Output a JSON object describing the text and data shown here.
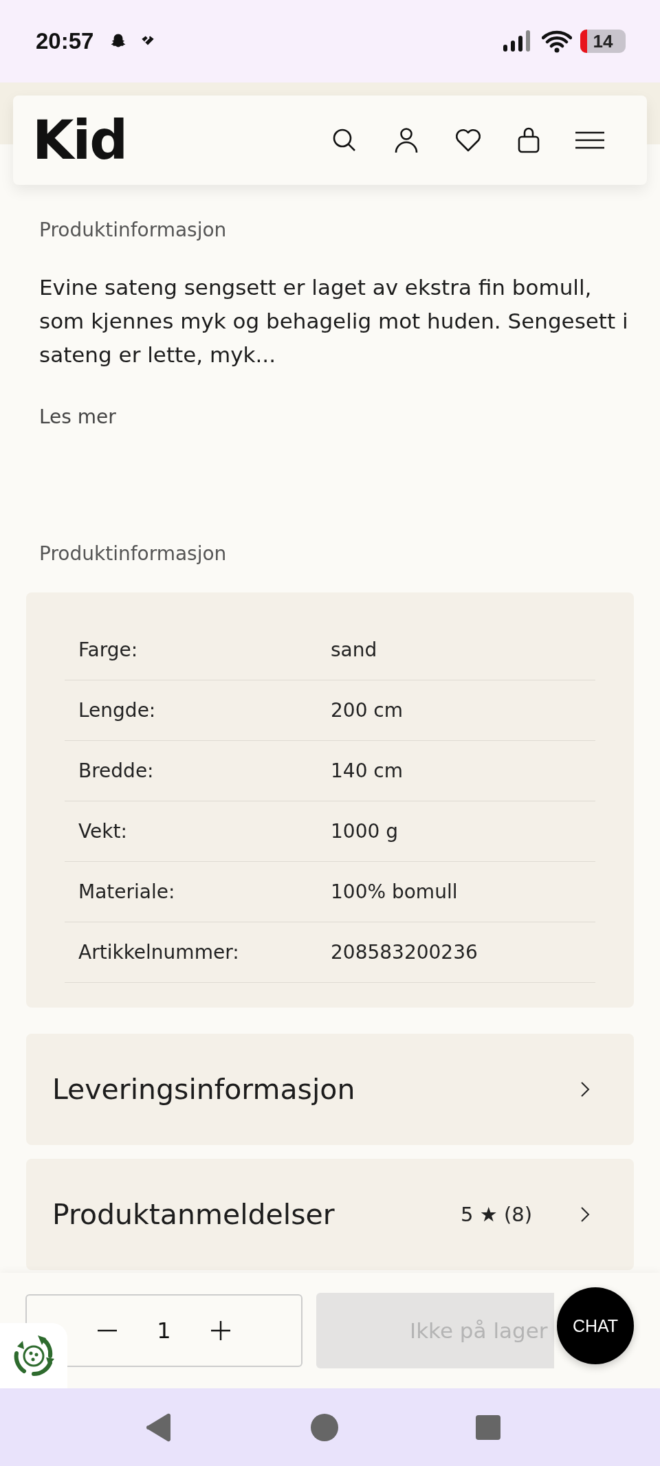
{
  "status_bar": {
    "time": "20:57",
    "battery": "14"
  },
  "header": {
    "logo": "Kid"
  },
  "description": {
    "heading": "Produktinformasjon",
    "text": "Evine sateng sengsett er laget av ekstra fin bomull, som kjennes myk og behagelig mot huden. Sengesett i sateng er lette, myk...",
    "more_link": "Les mer"
  },
  "specs": {
    "heading": "Produktinformasjon",
    "rows": [
      {
        "label": "Farge:",
        "value": "sand"
      },
      {
        "label": "Lengde:",
        "value": "200 cm"
      },
      {
        "label": "Bredde:",
        "value": "140 cm"
      },
      {
        "label": "Vekt:",
        "value": "1000 g"
      },
      {
        "label": "Materiale:",
        "value": "100% bomull"
      },
      {
        "label": "Artikkelnummer:",
        "value": "208583200236"
      }
    ]
  },
  "sections": [
    {
      "title": "Leveringsinformasjon"
    },
    {
      "title": "Produktanmeldelser",
      "rating": "5 ★ (8)"
    }
  ],
  "cart_bar": {
    "quantity": "1",
    "button": {
      "label": "Ikke på lager",
      "disabled": true
    }
  },
  "chat": {
    "label": "CHAT"
  }
}
